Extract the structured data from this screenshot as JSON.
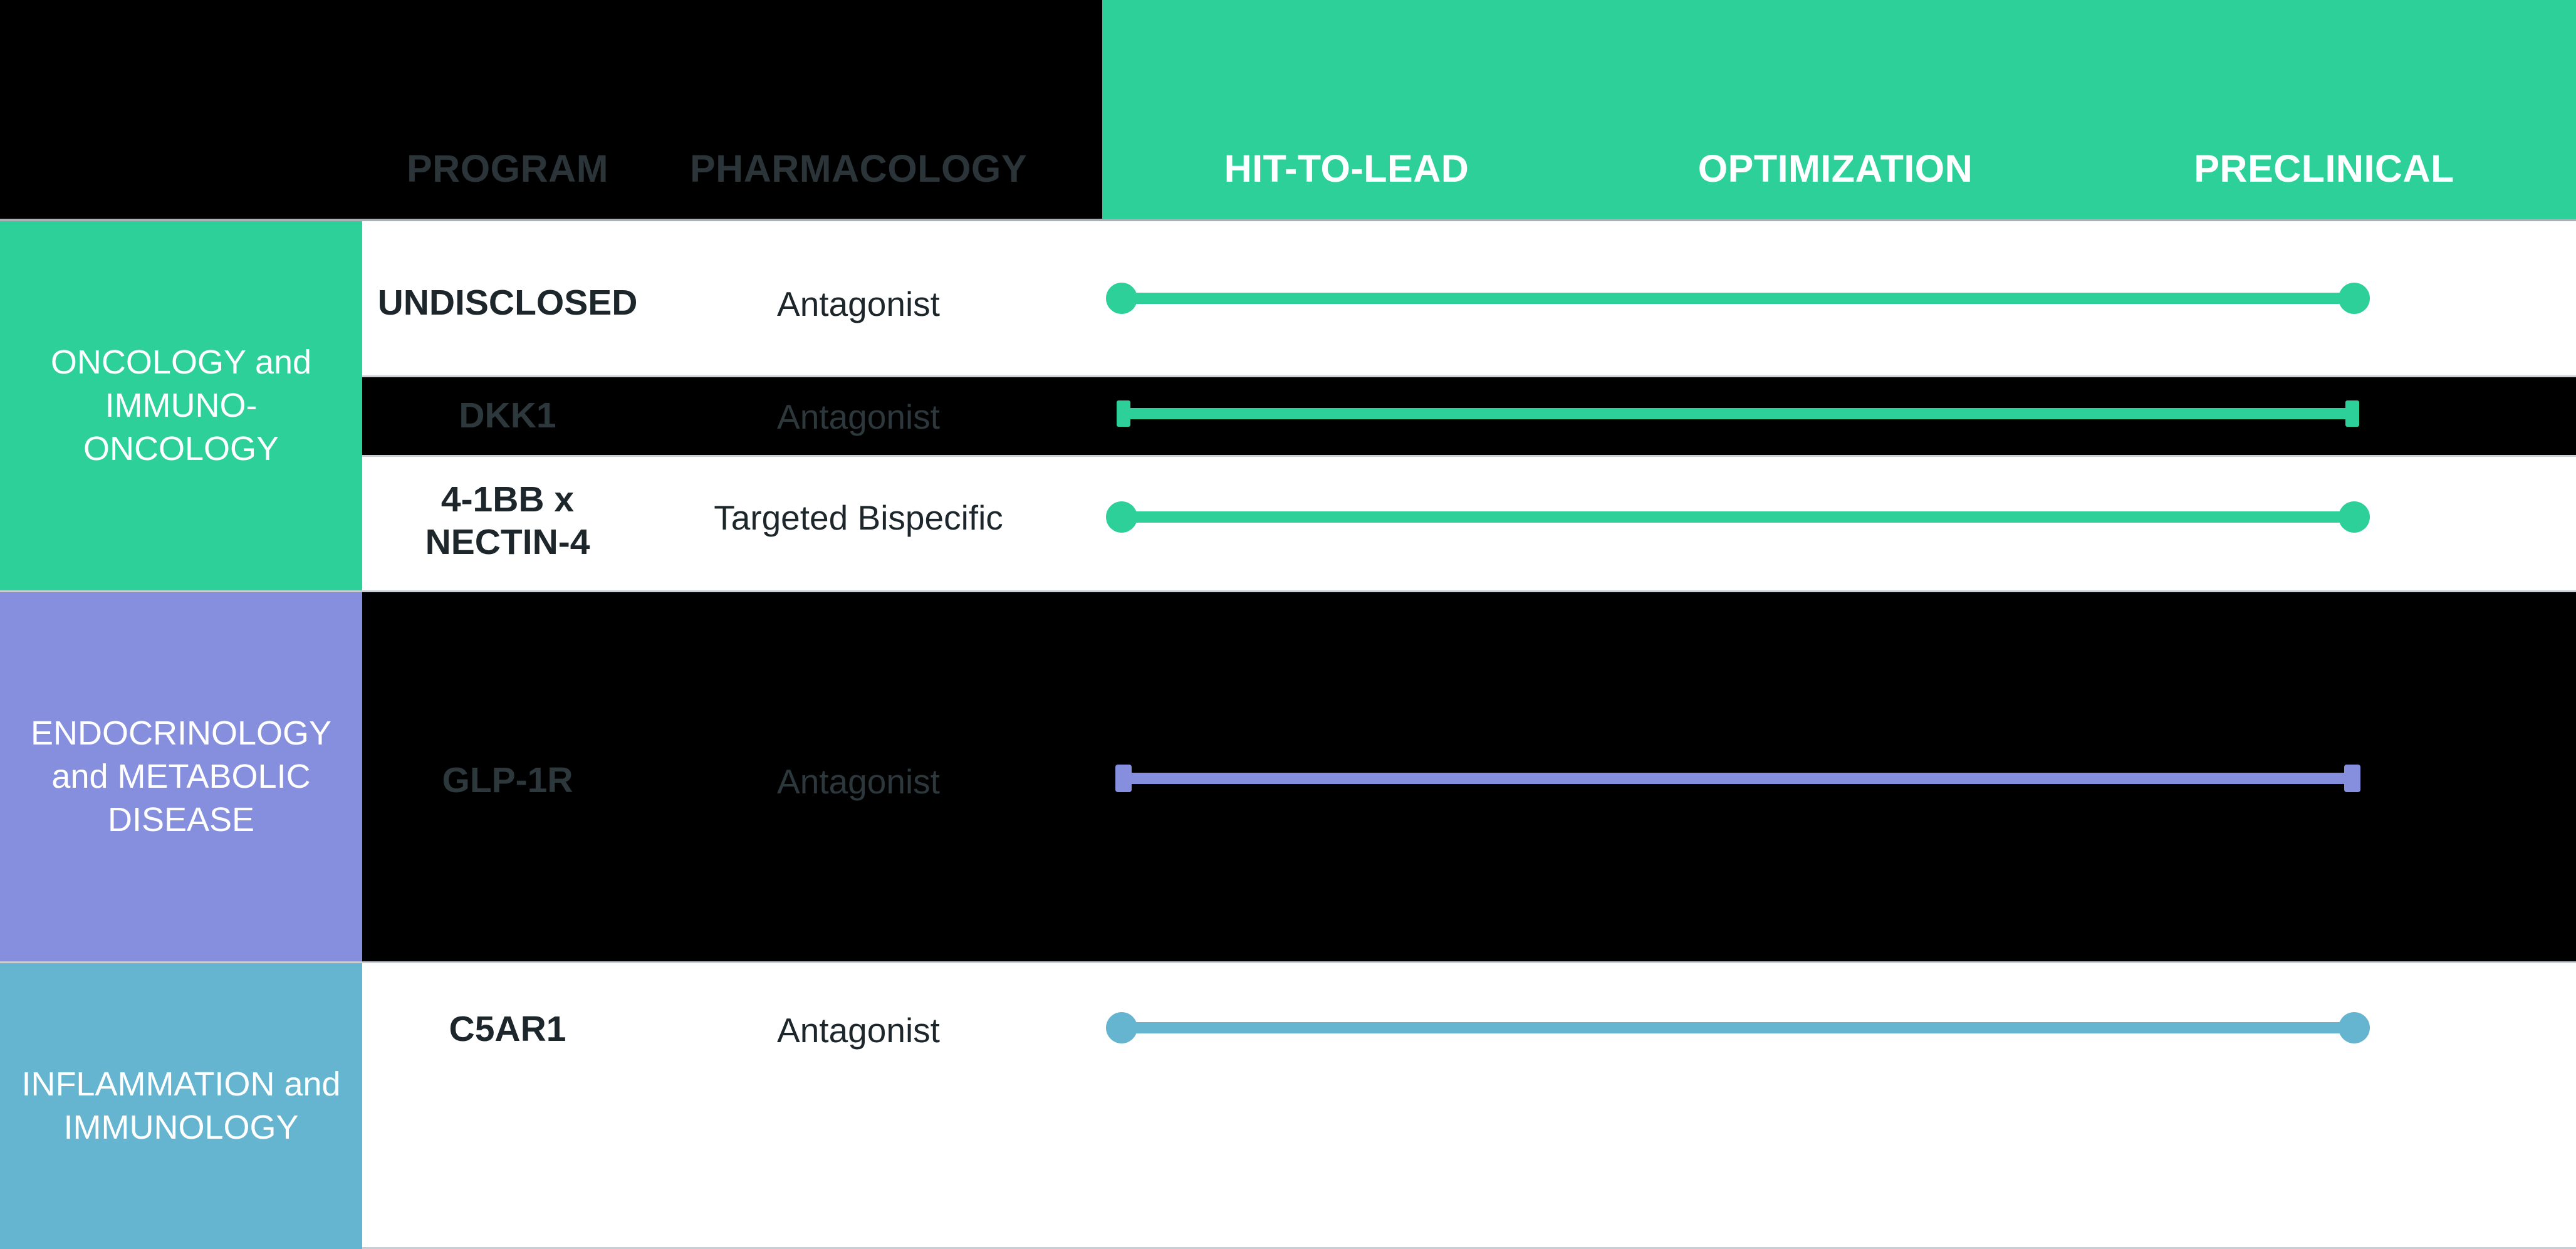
{
  "header": {
    "columns": [
      {
        "label": "PROGRAM",
        "name": "program"
      },
      {
        "label": "PHARMACOLOGY",
        "name": "pharmacology"
      }
    ],
    "stages": [
      {
        "label": "HIT-TO-LEAD"
      },
      {
        "label": "OPTIMIZATION"
      },
      {
        "label": "PRECLINICAL"
      }
    ]
  },
  "categories": [
    {
      "label": "ONCOLOGY and IMMUNO-ONCOLOGY",
      "color": "#2ed09a"
    },
    {
      "label": "ENDOCRINOLOGY and METABOLIC DISEASE",
      "color": "#868fde"
    },
    {
      "label": "INFLAMMATION and IMMUNOLOGY",
      "color": "#66b5d0"
    }
  ],
  "rows": [
    {
      "program": "UNDISCLOSED",
      "pharmacology": "Antagonist",
      "bar_color": "#2ed09a"
    },
    {
      "program": "DKK1",
      "pharmacology": "Antagonist",
      "bar_color": "#2ed09a"
    },
    {
      "program": "4-1BB x NECTIN-4",
      "pharmacology": "Targeted Bispecific",
      "bar_color": "#2ed09a"
    },
    {
      "program": "GLP-1R",
      "pharmacology": "Antagonist",
      "bar_color": "#868fde"
    },
    {
      "program": "C5AR1",
      "pharmacology": "Antagonist",
      "bar_color": "#66b5d0"
    }
  ],
  "chart_data": {
    "type": "bar",
    "title": "",
    "xlabel": "",
    "ylabel": "",
    "stages": [
      "HIT-TO-LEAD",
      "OPTIMIZATION",
      "PRECLINICAL"
    ],
    "categories": [
      "ONCOLOGY and IMMUNO-ONCOLOGY",
      "ENDOCRINOLOGY and METABOLIC DISEASE",
      "INFLAMMATION and IMMUNOLOGY"
    ],
    "series": [
      {
        "name": "UNDISCLOSED",
        "category": "ONCOLOGY and IMMUNO-ONCOLOGY",
        "pharmacology": "Antagonist",
        "start_stage": "HIT-TO-LEAD",
        "end_stage": "PRECLINICAL",
        "progress": 1.0,
        "color": "#2ed09a"
      },
      {
        "name": "DKK1",
        "category": "ONCOLOGY and IMMUNO-ONCOLOGY",
        "pharmacology": "Antagonist",
        "start_stage": "HIT-TO-LEAD",
        "end_stage": "PRECLINICAL",
        "progress": 1.0,
        "color": "#2ed09a"
      },
      {
        "name": "4-1BB x NECTIN-4",
        "category": "ONCOLOGY and IMMUNO-ONCOLOGY",
        "pharmacology": "Targeted Bispecific",
        "start_stage": "HIT-TO-LEAD",
        "end_stage": "PRECLINICAL",
        "progress": 1.0,
        "color": "#2ed09a"
      },
      {
        "name": "GLP-1R",
        "category": "ENDOCRINOLOGY and METABOLIC DISEASE",
        "pharmacology": "Antagonist",
        "start_stage": "HIT-TO-LEAD",
        "end_stage": "PRECLINICAL",
        "progress": 1.0,
        "color": "#868fde"
      },
      {
        "name": "C5AR1",
        "category": "INFLAMMATION and IMMUNOLOGY",
        "pharmacology": "Antagonist",
        "start_stage": "HIT-TO-LEAD",
        "end_stage": "PRECLINICAL",
        "progress": 1.0,
        "color": "#66b5d0"
      }
    ],
    "legend": "none",
    "grid": false
  },
  "colors": {
    "green": "#2ed09a",
    "purple": "#868fde",
    "blue": "#66b5d0",
    "black": "#000000",
    "divider": "#c9ced4",
    "header_dim_text": "#2b3438"
  }
}
